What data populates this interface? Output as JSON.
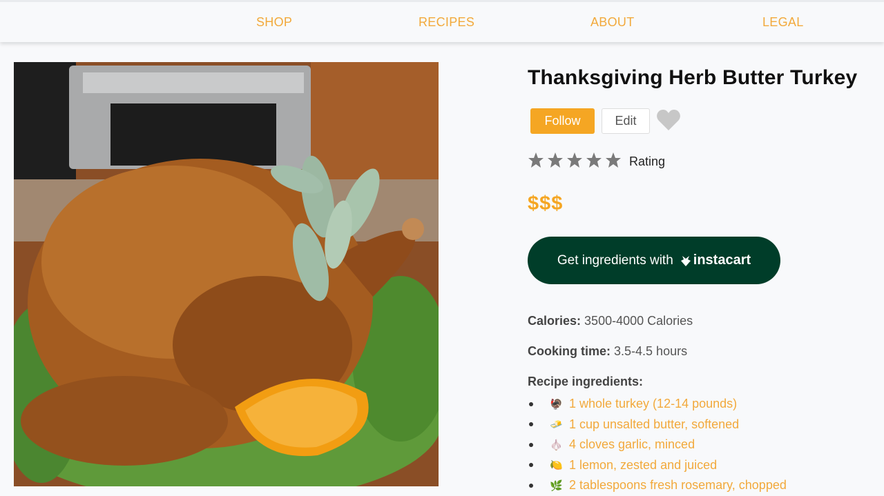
{
  "nav": {
    "items": [
      {
        "label": "SHOP"
      },
      {
        "label": "RECIPES"
      },
      {
        "label": "ABOUT"
      },
      {
        "label": "LEGAL"
      }
    ]
  },
  "recipe": {
    "title": "Thanksgiving Herb Butter Turkey",
    "follow_label": "Follow",
    "edit_label": "Edit",
    "rating": {
      "stars_filled": 5,
      "stars_total": 5,
      "label": "Rating"
    },
    "price": "$$$",
    "instacart": {
      "prefix": "Get ingredients with",
      "brand": "instacart",
      "brand_color": "#003d29"
    },
    "calories": {
      "label": "Calories:",
      "value": "3500-4000 Calories"
    },
    "cooking_time": {
      "label": "Cooking time:",
      "value": "3.5-4.5 hours"
    },
    "ingredients_heading": "Recipe ingredients:",
    "ingredients": [
      {
        "icon": "turkey-icon",
        "glyph": "🦃",
        "text": "1 whole turkey (12-14 pounds)"
      },
      {
        "icon": "butter-icon",
        "glyph": "🧈",
        "text": "1 cup unsalted butter, softened"
      },
      {
        "icon": "garlic-icon",
        "glyph": "🧄",
        "text": "4 cloves garlic, minced"
      },
      {
        "icon": "lemon-icon",
        "glyph": "🍋",
        "text": "1 lemon, zested and juiced"
      },
      {
        "icon": "herb-icon",
        "glyph": "🌿",
        "text": "2 tablespoons fresh rosemary, chopped"
      }
    ]
  },
  "colors": {
    "accent": "#f5a623",
    "nav_link": "#f2a93b",
    "instacart_green": "#003d29"
  }
}
